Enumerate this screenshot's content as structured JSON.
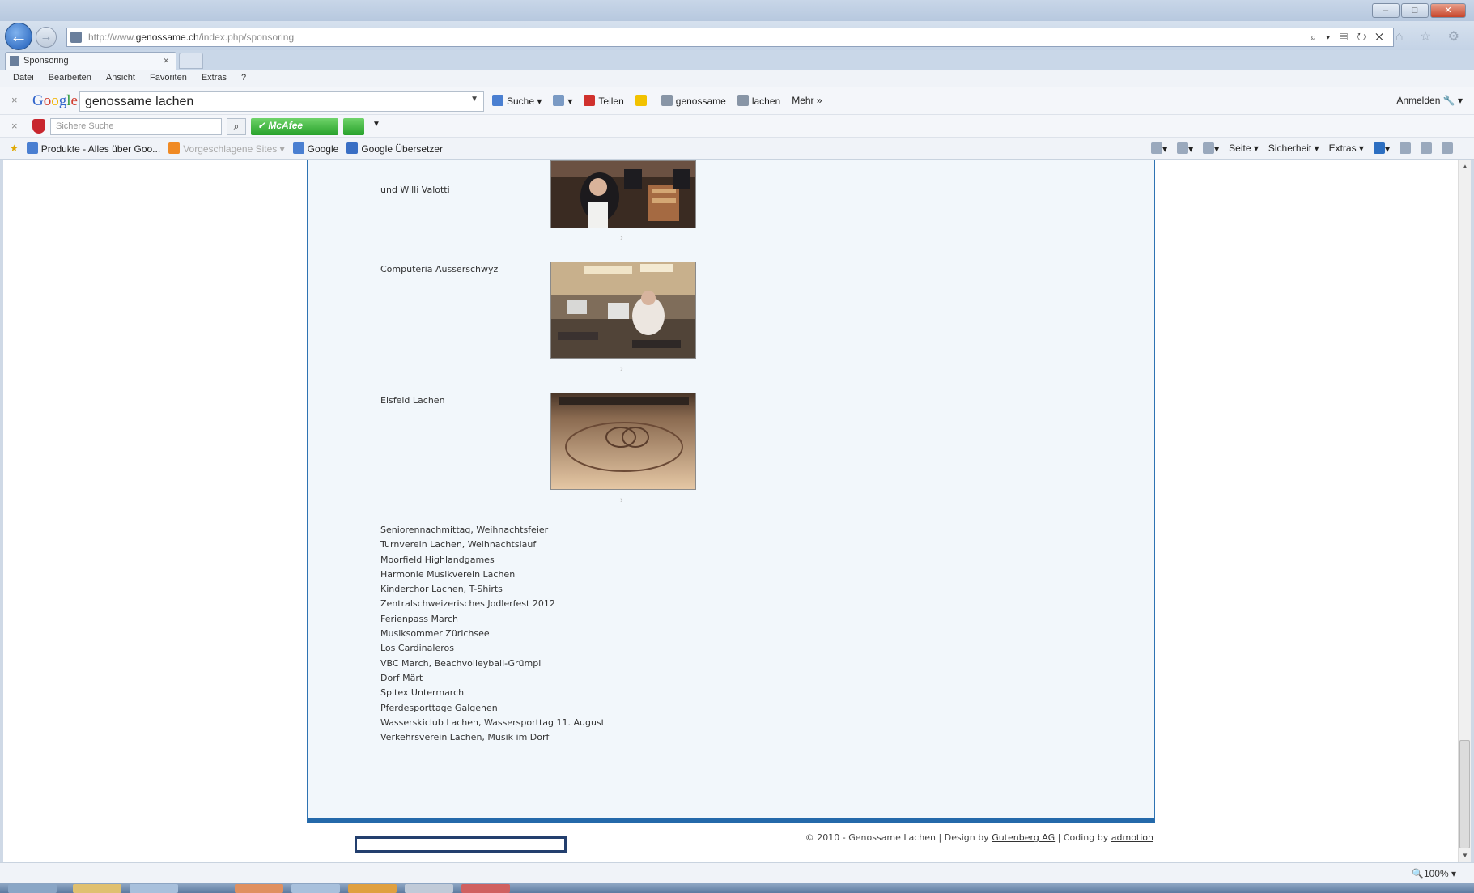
{
  "window": {
    "minimize": "–",
    "maximize": "□",
    "close": "✕"
  },
  "address": {
    "url_prefix": "http://www.",
    "url_domain": "genossame.ch",
    "url_path": "/index.php/sponsoring",
    "tools": "⌕ ▾ ▤ ↻ ✕",
    "fav_tools": "⌂ ☆ ⚙"
  },
  "tab": {
    "label": "Sponsoring",
    "close": "×"
  },
  "menu": [
    "Datei",
    "Bearbeiten",
    "Ansicht",
    "Favoriten",
    "Extras",
    "?"
  ],
  "google_toolbar": {
    "logo": [
      "G",
      "o",
      "o",
      "g",
      "l",
      "e"
    ],
    "search_value": "genossame lachen",
    "buttons": [
      "Suche ▾",
      "▾",
      "Teilen",
      "genossame",
      "lachen",
      "Mehr »"
    ],
    "signin": "Anmelden 🔧 ▾"
  },
  "mcafee": {
    "placeholder": "Sichere Suche",
    "brand": "McAfee"
  },
  "favorites": {
    "items": [
      "Produkte - Alles über Goo...",
      "Vorgeschlagene Sites ▾",
      "Google",
      "Google Übersetzer"
    ],
    "cmd": [
      "▾",
      "▾",
      "▾",
      "Seite ▾",
      "Sicherheit ▾",
      "Extras ▾",
      "▾"
    ]
  },
  "page": {
    "entries": [
      {
        "label": "und Willi Valotti"
      },
      {
        "label": "Computeria Ausserschwyz"
      },
      {
        "label": "Eisfeld Lachen"
      }
    ],
    "arrow": "›",
    "sponsors": [
      "Seniorennachmittag, Weihnachtsfeier",
      "Turnverein Lachen, Weihnachtslauf",
      "Moorfield Highlandgames",
      "Harmonie Musikverein Lachen",
      "Kinderchor Lachen, T-Shirts",
      "Zentralschweizerisches Jodlerfest 2012",
      "Ferienpass March",
      "Musiksommer Zürichsee",
      "Los Cardinaleros",
      "VBC March, Beachvolleyball-Grümpi",
      "Dorf Märt",
      "Spitex Untermarch",
      "Pferdesporttage Galgenen",
      "Wasserskiclub Lachen, Wassersporttag 11. August",
      "Verkehrsverein Lachen, Musik im Dorf"
    ],
    "footer": {
      "prefix": "© 2010 - Genossame Lachen | Design by ",
      "design_link": "Gutenberg AG",
      "mid": " | Coding by ",
      "coding_link": "admotion"
    }
  },
  "status": {
    "zoom": "🔍100% ▾"
  }
}
